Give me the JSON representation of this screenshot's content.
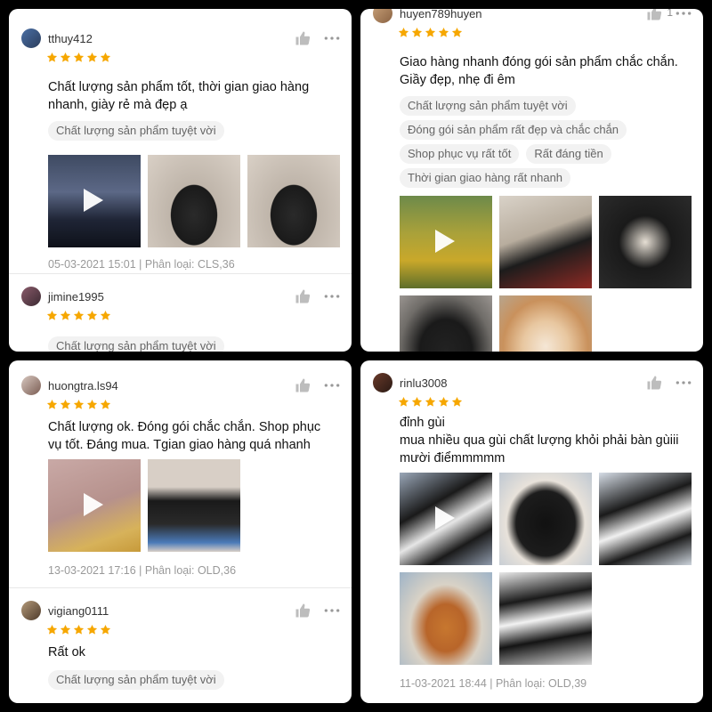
{
  "panel1": {
    "review1": {
      "username": "tthuy412",
      "rating": 5,
      "text": "Chất lượng sản phẩm tốt, thời gian giao hàng nhanh, giày rẻ mà đẹp ạ",
      "tags": [
        "Chất lượng sản phẩm tuyệt vời"
      ],
      "thumbs": [
        "video-night-sky",
        "shoe-photo",
        "shoe-photo"
      ],
      "meta": "05-03-2021 15:01 | Phân loại: CLS,36"
    },
    "review2": {
      "username": "jimine1995",
      "rating": 5,
      "tags": [
        "Chất lượng sản phẩm tuyệt vời"
      ]
    }
  },
  "panel2": {
    "review1": {
      "username": "huyen789huyen",
      "like_count": "1",
      "rating": 5,
      "text": "Giao hàng nhanh đóng gói sản phẩm chắc chắn. Giầy đẹp, nhẹ đi êm",
      "tags": [
        "Chất lượng sản phẩm tuyệt vời",
        "Đóng gói sản phẩm rất đẹp và chắc chắn",
        "Shop phục vụ rất tốt",
        "Rất đáng tiền",
        "Thời gian giao hàng rất nhanh"
      ],
      "thumbs": [
        "video-flower-field",
        "shoe-photo",
        "shoe-photo",
        "shoe-photo",
        "dog-photo"
      ]
    }
  },
  "panel3": {
    "review1": {
      "username": "huongtra.ls94",
      "rating": 5,
      "text": "Chất lượng ok. Đóng gói chắc chắn. Shop phục vụ tốt. Đáng mua. Tgian giao hàng quá nhanh",
      "thumbs": [
        "video-pink",
        "shoe-photo"
      ],
      "meta": "13-03-2021 17:16 | Phân loại: OLD,36"
    },
    "review2": {
      "username": "vigiang0111",
      "rating": 5,
      "text": "Rất ok",
      "tags": [
        "Chất lượng sản phẩm tuyệt vời"
      ]
    }
  },
  "panel4": {
    "review1": {
      "username": "rinlu3008",
      "rating": 5,
      "text": "đỉnh gùi\nmua nhiều qua gùi chất lượng khỏi phải bàn gùiii mười điểmmmmm",
      "thumbs": [
        "video-shoe",
        "shoe-photo",
        "shoe-photo",
        "shoe-sole-photo",
        "shoe-photo"
      ],
      "meta": "11-03-2021 18:44 | Phân loại: OLD,39"
    }
  },
  "colors": {
    "star": "#f6a700",
    "tag_bg": "#f2f2f2",
    "meta": "#999999"
  },
  "icons": [
    "thumbs-up-icon",
    "more-icon",
    "star-icon",
    "play-icon"
  ]
}
